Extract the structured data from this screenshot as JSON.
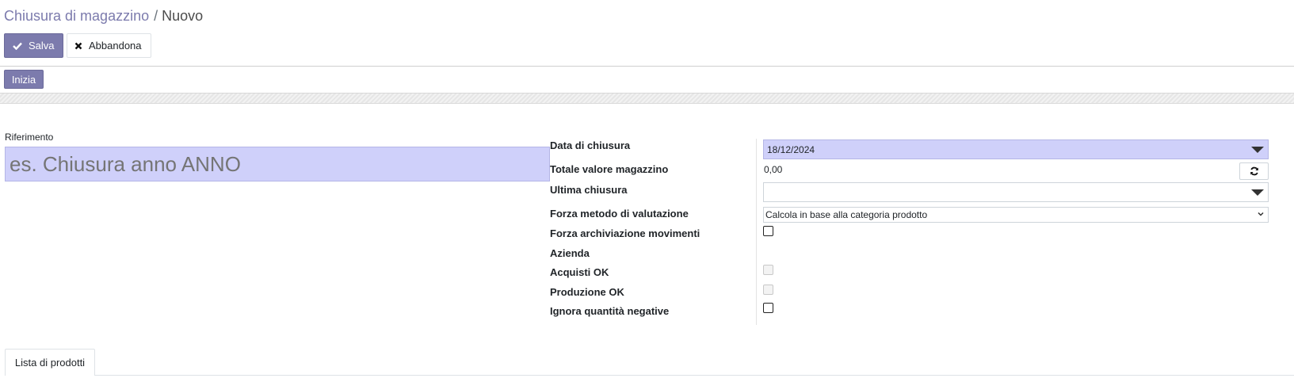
{
  "breadcrumb": {
    "parent": "Chiusura di magazzino",
    "separator": "/",
    "current": "Nuovo"
  },
  "toolbar": {
    "save_label": "Salva",
    "discard_label": "Abbandona"
  },
  "statusbar": {
    "start_label": "Inizia"
  },
  "form": {
    "reference": {
      "label": "Riferimento",
      "placeholder": "es. Chiusura anno ANNO",
      "value": ""
    },
    "fields": {
      "closing_date": {
        "label": "Data di chiusura",
        "value": "18/12/2024"
      },
      "total_value": {
        "label": "Totale valore magazzino",
        "value": "0,00"
      },
      "last_closing": {
        "label": "Ultima chiusura",
        "value": ""
      },
      "valuation_method": {
        "label": "Forza metodo di valutazione",
        "value": "Calcola in base alla categoria prodotto"
      },
      "archive_moves": {
        "label": "Forza archiviazione movimenti",
        "checked": false
      },
      "company": {
        "label": "Azienda",
        "value": ""
      },
      "purchases_ok": {
        "label": "Acquisti OK",
        "checked": false,
        "disabled": true
      },
      "production_ok": {
        "label": "Produzione OK",
        "checked": false,
        "disabled": true
      },
      "ignore_negative": {
        "label": "Ignora quantità negative",
        "checked": false
      }
    }
  },
  "tabs": [
    {
      "label": "Lista di prodotti",
      "active": true
    }
  ],
  "colors": {
    "accent": "#7c7bad",
    "required_field_bg": "#cfd0fa"
  },
  "icons": {
    "save": "check-icon",
    "discard": "close-icon",
    "refresh": "refresh-icon",
    "dropdown": "caret-down-icon",
    "select": "chevron-down-icon"
  }
}
